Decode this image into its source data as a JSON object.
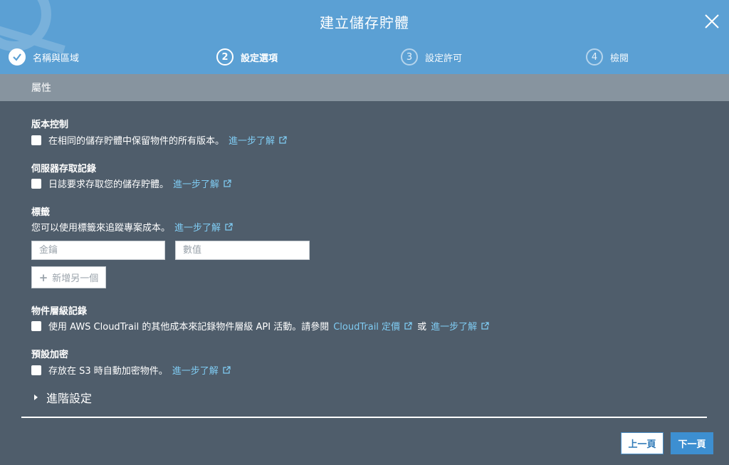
{
  "window": {
    "title": "建立儲存貯體"
  },
  "steps": [
    {
      "number": "1",
      "label": "名稱與區域",
      "state": "done"
    },
    {
      "number": "2",
      "label": "設定選項",
      "state": "active"
    },
    {
      "number": "3",
      "label": "設定許可",
      "state": "inactive"
    },
    {
      "number": "4",
      "label": "檢閱",
      "state": "inactive"
    }
  ],
  "section": {
    "title": "屬性"
  },
  "versioning": {
    "title": "版本控制",
    "text": "在相同的儲存貯體中保留物件的所有版本。",
    "link": "進一步了解"
  },
  "access_logging": {
    "title": "伺服器存取記錄",
    "text": "日誌要求存取您的儲存貯體。",
    "link": "進一步了解"
  },
  "tags": {
    "title": "標籤",
    "description": "您可以使用標籤來追蹤專案成本。",
    "link": "進一步了解",
    "key_placeholder": "金鑰",
    "value_placeholder": "數值",
    "add_button": "新增另一個"
  },
  "object_logging": {
    "title": "物件層級記錄",
    "text": "使用 AWS CloudTrail 的其他成本來記錄物件層級 API 活動。請參閱",
    "pricing_link": "CloudTrail 定價",
    "or_text": "或",
    "link": "進一步了解"
  },
  "encryption": {
    "title": "預設加密",
    "text": "存放在 S3 時自動加密物件。",
    "link": "進一步了解"
  },
  "advanced": {
    "label": "進階設定"
  },
  "footer": {
    "prev_label": "上一頁",
    "next_label": "下一頁"
  },
  "colors": {
    "header": "#5ba0d4",
    "body": "#4f5d6b",
    "section_bar": "#87949f",
    "link": "#7fcbf2",
    "primary_button": "#3d8fd1"
  }
}
